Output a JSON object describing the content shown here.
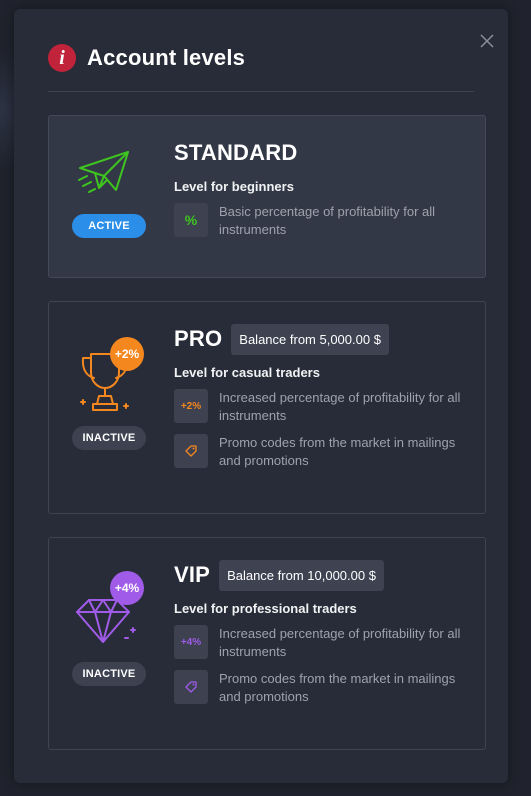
{
  "modal": {
    "title": "Account levels"
  },
  "levels": [
    {
      "name": "STANDARD",
      "description": "Level for beginners",
      "status": "ACTIVE",
      "features": [
        {
          "icon_text": "%",
          "text": "Basic percentage of profitability for all instruments"
        }
      ]
    },
    {
      "name": "PRO",
      "balance": "Balance from 5,000.00 $",
      "badge": "+2%",
      "description": "Level for casual traders",
      "status": "INACTIVE",
      "features": [
        {
          "icon_text": "+2%",
          "text": "Increased percentage of profitability for all instruments"
        },
        {
          "icon_text": "",
          "text": "Promo codes from the market in mailings and promotions"
        }
      ]
    },
    {
      "name": "VIP",
      "balance": "Balance from 10,000.00 $",
      "badge": "+4%",
      "description": "Level for professional traders",
      "status": "INACTIVE",
      "features": [
        {
          "icon_text": "+4%",
          "text": "Increased percentage of profitability for all instruments"
        },
        {
          "icon_text": "",
          "text": "Promo codes from the market in mailings and promotions"
        }
      ]
    }
  ],
  "colors": {
    "standard_accent": "#3ec51f",
    "pro_accent": "#f5871f",
    "vip_accent": "#a05ce8",
    "active_status": "#2b8ee8",
    "info_icon": "#c0233a"
  },
  "icons": {
    "info": "info-icon",
    "close": "close-icon",
    "standard": "paper-plane-icon",
    "pro": "trophy-icon",
    "vip": "diamond-icon",
    "promo": "tag-icon"
  }
}
